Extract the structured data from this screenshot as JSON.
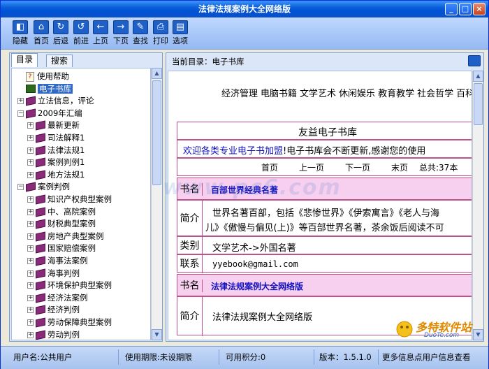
{
  "window": {
    "title": "法律法规案例大全网络版",
    "controls": [
      "_",
      "□",
      "×"
    ]
  },
  "toolbar": {
    "items": [
      {
        "label": "隐藏",
        "icon": "hide-icon",
        "glyph": "◧"
      },
      {
        "label": "首页",
        "icon": "home-icon",
        "glyph": "⌂"
      },
      {
        "label": "后退",
        "icon": "back-rotate-icon",
        "glyph": "↻"
      },
      {
        "label": "前进",
        "icon": "forward-rotate-icon",
        "glyph": "↺"
      },
      {
        "label": "上页",
        "icon": "arrow-left-icon",
        "glyph": "←"
      },
      {
        "label": "下页",
        "icon": "arrow-right-icon",
        "glyph": "→"
      },
      {
        "label": "查找",
        "icon": "search-icon",
        "glyph": "✎"
      },
      {
        "label": "打印",
        "icon": "print-icon",
        "glyph": "⎙"
      },
      {
        "label": "选项",
        "icon": "options-icon",
        "glyph": "▤"
      }
    ]
  },
  "sidebar": {
    "tabs": [
      "目录",
      "搜索"
    ],
    "tree": [
      {
        "label": "使用帮助",
        "type": "help",
        "level": 0,
        "expander": ""
      },
      {
        "label": "电子书库",
        "type": "library",
        "level": 0,
        "expander": "",
        "selected": true
      },
      {
        "label": "立法信息，评论",
        "type": "book",
        "level": 0,
        "expander": "+"
      },
      {
        "label": "2009年汇编",
        "type": "book",
        "level": 0,
        "expander": "−"
      },
      {
        "label": "最新更新",
        "type": "book",
        "level": 1,
        "expander": "+"
      },
      {
        "label": "司法解释1",
        "type": "book",
        "level": 1,
        "expander": "+"
      },
      {
        "label": "法律法规1",
        "type": "book",
        "level": 1,
        "expander": "+"
      },
      {
        "label": "案例判例1",
        "type": "book",
        "level": 1,
        "expander": "+"
      },
      {
        "label": "地方法规1",
        "type": "book",
        "level": 1,
        "expander": "+"
      },
      {
        "label": "案例判例",
        "type": "book",
        "level": 0,
        "expander": "−"
      },
      {
        "label": "知识产权典型案例",
        "type": "book",
        "level": 1,
        "expander": "+"
      },
      {
        "label": "中、高院案例",
        "type": "book",
        "level": 1,
        "expander": "+"
      },
      {
        "label": "财税典型案例",
        "type": "book",
        "level": 1,
        "expander": "+"
      },
      {
        "label": "房地产典型案例",
        "type": "book",
        "level": 1,
        "expander": "+"
      },
      {
        "label": "国家赔偿案例",
        "type": "book",
        "level": 1,
        "expander": "+"
      },
      {
        "label": "海事法案例",
        "type": "book",
        "level": 1,
        "expander": "+"
      },
      {
        "label": "海事判例",
        "type": "book",
        "level": 1,
        "expander": "+"
      },
      {
        "label": "环境保护典型案例",
        "type": "book",
        "level": 1,
        "expander": "+"
      },
      {
        "label": "经济法案例",
        "type": "book",
        "level": 1,
        "expander": "+"
      },
      {
        "label": "经济判例",
        "type": "book",
        "level": 1,
        "expander": "+"
      },
      {
        "label": "劳动保障典型案例",
        "type": "book",
        "level": 1,
        "expander": "+"
      },
      {
        "label": "劳动判例",
        "type": "book",
        "level": 1,
        "expander": "+"
      }
    ]
  },
  "main": {
    "current_dir": "当前目录：电子书库",
    "categories": [
      "经济管理",
      "电脑书籍",
      "文学艺术",
      "休闲娱乐",
      "教育教学",
      "社会哲学",
      "百科知"
    ],
    "library_title": "友益电子书库",
    "welcome_link": "欢迎各类专业电子书加盟",
    "welcome_text": "!电子书库会不断更新,感谢您的使用",
    "pager": {
      "first": "首页",
      "prev": "上一页",
      "next": "下一页",
      "last": "末页",
      "total": "总共:37本"
    },
    "labels": {
      "name": "书名",
      "intro": "简介",
      "category": "类别",
      "contact": "联系"
    },
    "books": [
      {
        "name": "百部世界经典名著",
        "intro_1": "世界名著百部，包括《悲惨世界》《伊索寓言》《老人与海",
        "intro_2": "儿》《傲慢与偏见(上)》等百部世界名著，茶余饭后阅读不可",
        "category": "文学艺术->外国名著",
        "contact": "yyebook@gmail.com"
      },
      {
        "name": "法律法规案例大全网络版",
        "intro_1": "法律法规案例大全网络版"
      }
    ]
  },
  "statusbar": {
    "user": "用户名:公共用户",
    "expiry": "使用期限:未设期限",
    "points": "可用积分:0",
    "version": "版本：1.5.1.0",
    "info": "更多信息点用户信息查看"
  },
  "watermark": "www.pc6.com",
  "logo": {
    "text": "多特软件站",
    "sub": "DuoTe.com"
  }
}
